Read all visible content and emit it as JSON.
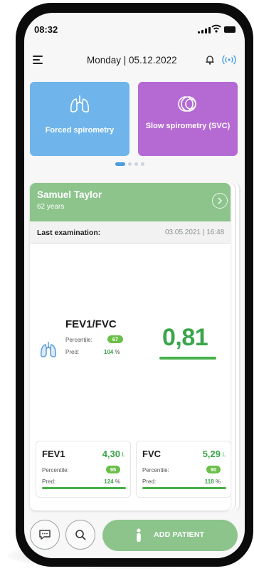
{
  "status_bar": {
    "time": "08:32"
  },
  "header": {
    "date": "Monday | 05.12.2022"
  },
  "icons": {
    "menu": "hamburger-menu-icon",
    "bell": "bell-icon",
    "device": "wireless-signal-icon",
    "forced": "lungs-icon",
    "slow": "concentric-circles-icon",
    "patient_next": "chevron-right-icon",
    "metric_lungs": "lungs-icon",
    "chat": "chat-icon",
    "search": "search-icon",
    "person": "person-icon"
  },
  "tiles": [
    {
      "label": "Forced spirometry",
      "color": "#6fb4ea"
    },
    {
      "label": "Slow spirometry (SVC)",
      "color": "#b56ad3"
    }
  ],
  "carousel": {
    "pages": 4,
    "active": 0
  },
  "patient": {
    "name": "Samuel Taylor",
    "age": "62 years",
    "exam_label": "Last examination:",
    "exam_date": "03.05.2021 | 16:48"
  },
  "main_metric": {
    "name": "FEV1/FVC",
    "percentile_label": "Percentile:",
    "percentile": "67",
    "pred_label": "Pred:",
    "pred_value": "104",
    "pred_unit": "%",
    "value": "0,81"
  },
  "metrics": [
    {
      "name": "FEV1",
      "value": "4,30",
      "unit": "L",
      "percentile_label": "Percentile:",
      "percentile": "95",
      "pred_label": "Pred:",
      "pred_value": "124",
      "pred_unit": "%"
    },
    {
      "name": "FVC",
      "value": "5,29",
      "unit": "L",
      "percentile_label": "Percentile:",
      "percentile": "90",
      "pred_label": "Pred:",
      "pred_value": "118",
      "pred_unit": "%"
    }
  ],
  "bottom": {
    "add_patient": "ADD PATIENT"
  },
  "colors": {
    "accent_green": "#3aa54a",
    "patient_bar": "#8cc48c",
    "tile_blue": "#6fb4ea",
    "tile_purple": "#b56ad3"
  }
}
